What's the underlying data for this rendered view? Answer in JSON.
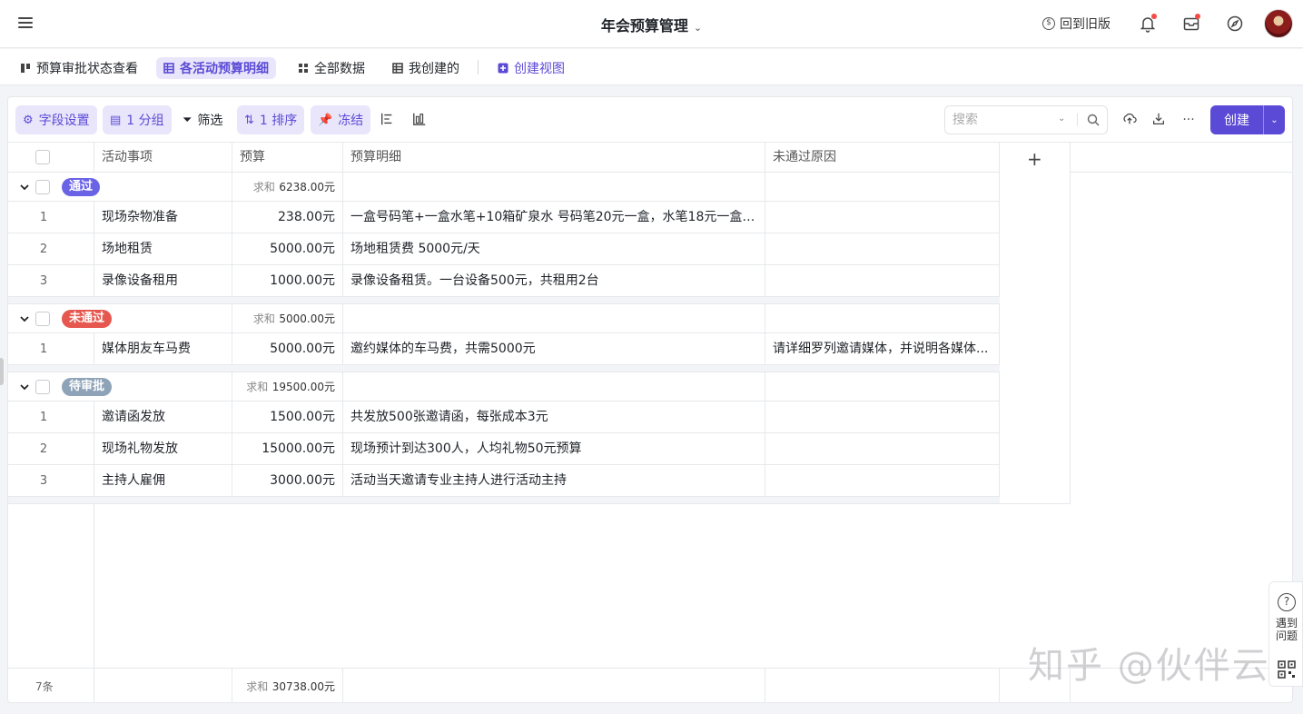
{
  "header": {
    "title": "年会预算管理",
    "old_version": "回到旧版"
  },
  "views": {
    "tabs": [
      {
        "label": "预算审批状态查看"
      },
      {
        "label": "各活动预算明细"
      },
      {
        "label": "全部数据"
      },
      {
        "label": "我创建的"
      }
    ],
    "create_view": "创建视图",
    "active_index": 1
  },
  "toolbar": {
    "field_settings": "字段设置",
    "group": "1 分组",
    "filter": "筛选",
    "sort": "1 排序",
    "freeze": "冻结",
    "search_placeholder": "搜索",
    "create": "创建"
  },
  "table": {
    "columns": [
      "活动事项",
      "预算",
      "预算明细",
      "未通过原因"
    ],
    "sum_prefix": "求和",
    "groups": [
      {
        "tag": "通过",
        "tag_color": "#6b63e6",
        "sum": "6238.00元",
        "rows": [
          {
            "idx": "1",
            "item": "现场杂物准备",
            "budget": "238.00元",
            "detail": "一盒号码笔+一盒水笔+10箱矿泉水   号码笔20元一盒，水笔18元一盒 ...",
            "reason": ""
          },
          {
            "idx": "2",
            "item": "场地租赁",
            "budget": "5000.00元",
            "detail": "场地租赁费  5000元/天",
            "reason": ""
          },
          {
            "idx": "3",
            "item": "录像设备租用",
            "budget": "1000.00元",
            "detail": "录像设备租赁。一台设备500元，共租用2台",
            "reason": ""
          }
        ]
      },
      {
        "tag": "未通过",
        "tag_color": "#e5574f",
        "sum": "5000.00元",
        "rows": [
          {
            "idx": "1",
            "item": "媒体朋友车马费",
            "budget": "5000.00元",
            "detail": "邀约媒体的车马费，共需5000元",
            "reason": "请详细罗列邀请媒体，并说明各媒体..."
          }
        ]
      },
      {
        "tag": "待审批",
        "tag_color": "#8ea3b8",
        "sum": "19500.00元",
        "rows": [
          {
            "idx": "1",
            "item": "邀请函发放",
            "budget": "1500.00元",
            "detail": "共发放500张邀请函，每张成本3元",
            "reason": ""
          },
          {
            "idx": "2",
            "item": "现场礼物发放",
            "budget": "15000.00元",
            "detail": "现场预计到达300人，人均礼物50元预算",
            "reason": ""
          },
          {
            "idx": "3",
            "item": "主持人雇佣",
            "budget": "3000.00元",
            "detail": "活动当天邀请专业主持人进行活动主持",
            "reason": ""
          }
        ]
      }
    ],
    "footer_count": "7条",
    "footer_sum": "30738.00元"
  },
  "help": {
    "label": "遇到问题"
  },
  "watermark": "知乎 @伙伴云"
}
